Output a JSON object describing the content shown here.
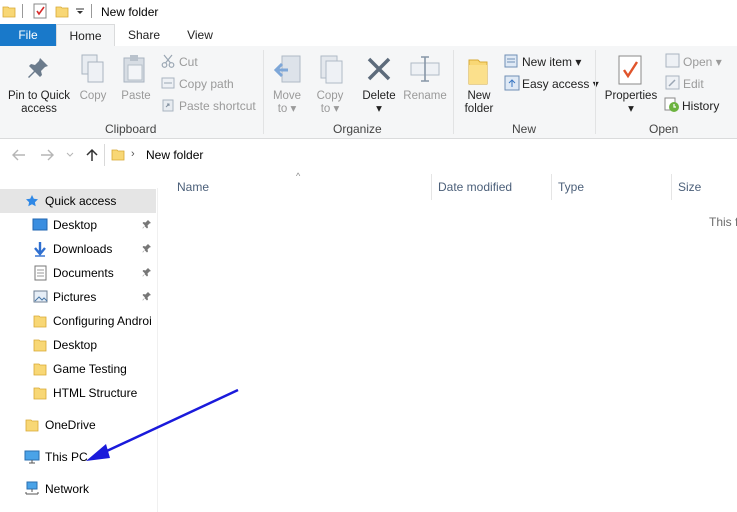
{
  "window": {
    "title": "New folder"
  },
  "tabs": {
    "file": "File",
    "home": "Home",
    "share": "Share",
    "view": "View"
  },
  "clipboard": {
    "label": "Clipboard",
    "pin_line1": "Pin to Quick",
    "pin_line2": "access",
    "copy": "Copy",
    "paste": "Paste",
    "cut": "Cut",
    "copy_path": "Copy path",
    "paste_shortcut": "Paste shortcut"
  },
  "organize": {
    "label": "Organize",
    "move_line1": "Move",
    "move_line2": "to",
    "copy_line1": "Copy",
    "copy_line2": "to",
    "delete": "Delete",
    "rename": "Rename"
  },
  "new": {
    "label": "New",
    "new_folder_line1": "New",
    "new_folder_line2": "folder",
    "new_item": "New item",
    "easy_access": "Easy access"
  },
  "open": {
    "label": "Open",
    "properties": "Properties",
    "open": "Open",
    "edit": "Edit",
    "history": "History"
  },
  "address": {
    "path": "New folder"
  },
  "nav": {
    "quick_access": "Quick access",
    "items": [
      "Desktop",
      "Downloads",
      "Documents",
      "Pictures",
      "Configuring Androi",
      "Desktop",
      "Game Testing",
      "HTML Structure"
    ],
    "onedrive": "OneDrive",
    "this_pc": "This PC",
    "network": "Network"
  },
  "columns": {
    "name": "Name",
    "date_modified": "Date modified",
    "type": "Type",
    "size": "Size"
  },
  "content": {
    "empty_text": "This f"
  },
  "colors": {
    "accent": "#1979ca",
    "arrow": "#1a1adb",
    "folder": "#f8d775"
  }
}
